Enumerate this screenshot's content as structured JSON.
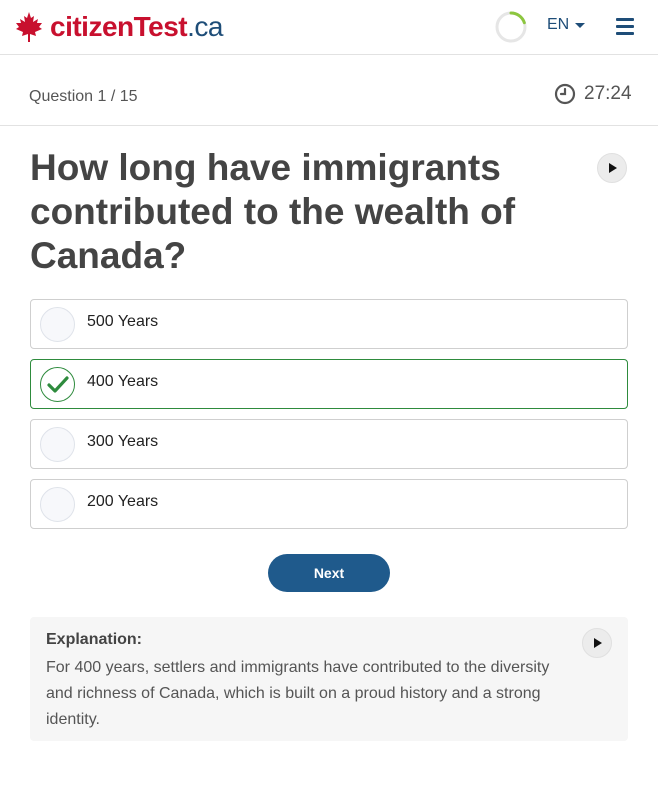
{
  "header": {
    "logo_main": "citizenTest",
    "logo_suffix": ".ca",
    "language": "EN",
    "progress_fraction": 0.2
  },
  "question_bar": {
    "counter": "Question 1 / 15",
    "timer": "27:24"
  },
  "question": {
    "text": "How long have immigrants contributed to the wealth of Canada?"
  },
  "options": [
    {
      "label": "500 Years",
      "selected": false
    },
    {
      "label": "400 Years",
      "selected": true
    },
    {
      "label": "300 Years",
      "selected": false
    },
    {
      "label": "200 Years",
      "selected": false
    }
  ],
  "next_label": "Next",
  "explanation": {
    "title": "Explanation:",
    "text": "For 400 years, settlers and immigrants have contributed to the diversity and richness of Canada, which is built on a proud history and a strong identity."
  },
  "colors": {
    "brand_red": "#c8102e",
    "brand_blue": "#1e4d78",
    "correct_green": "#2e8b3d",
    "button_blue": "#1f5a8c"
  }
}
